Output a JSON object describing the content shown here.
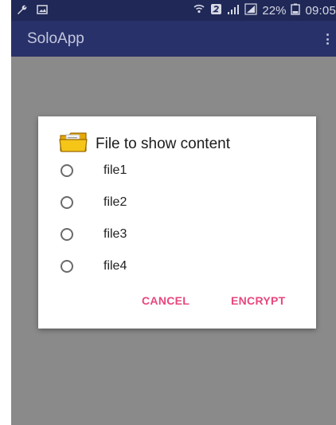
{
  "status_bar": {
    "battery_percent": "22%",
    "time": "09:05"
  },
  "app_bar": {
    "title": "SoloApp"
  },
  "dialog": {
    "title": "File to show content",
    "options": [
      {
        "label": "file1",
        "selected": false
      },
      {
        "label": "file2",
        "selected": false
      },
      {
        "label": "file3",
        "selected": false
      },
      {
        "label": "file4",
        "selected": false
      }
    ],
    "cancel_label": "CANCEL",
    "encrypt_label": "ENCRYPT"
  },
  "colors": {
    "status_bar": "#1f2856",
    "app_bar": "#283169",
    "scrim": "#8a8a8a",
    "accent": "#e8477d",
    "folder": "#f5c518"
  },
  "icons": [
    "wrench-icon",
    "image-icon",
    "wifi-icon",
    "sim-icon",
    "signal-icon",
    "signal-icon",
    "battery-icon",
    "folder-icon"
  ]
}
